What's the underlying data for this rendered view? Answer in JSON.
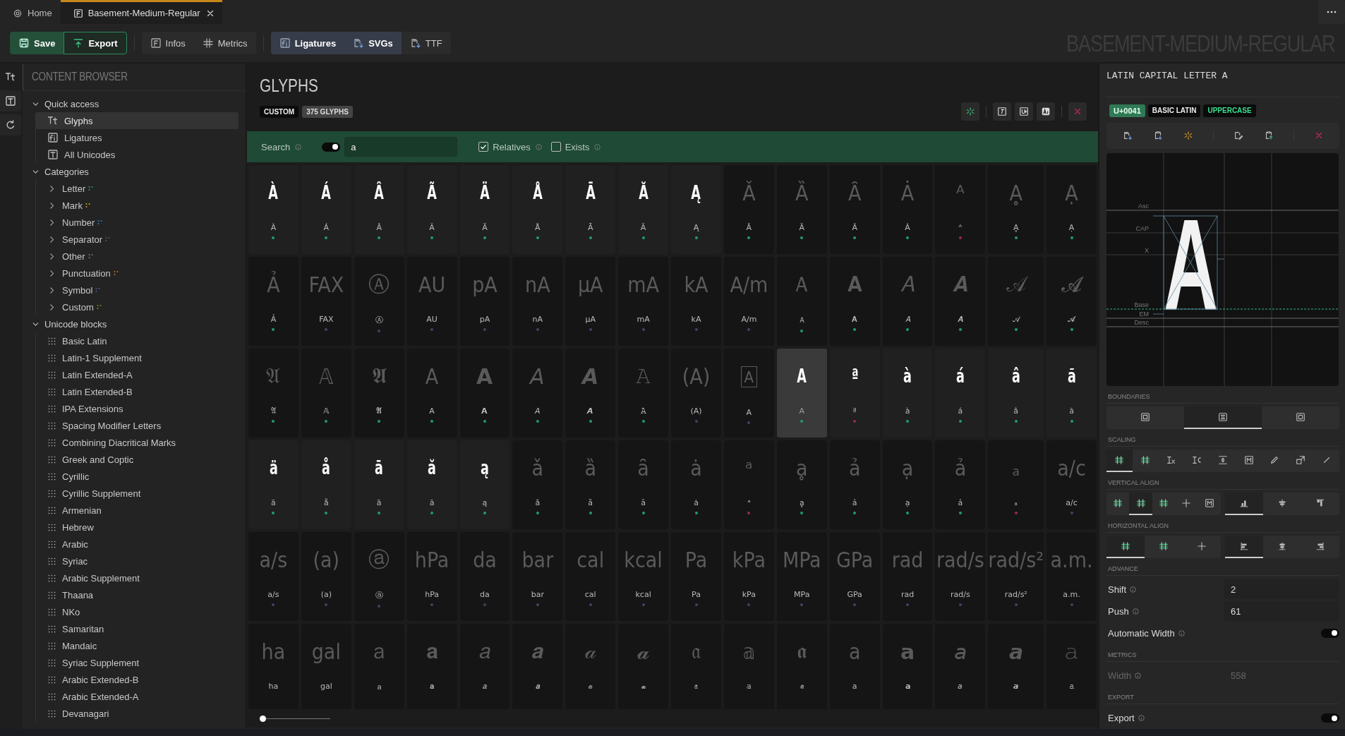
{
  "tabs": [
    {
      "label": "Home",
      "selected": false
    },
    {
      "label": "Basement-Medium-Regular",
      "selected": true
    }
  ],
  "toolbar": {
    "groups": [
      {
        "buttons": [
          {
            "label": "Save",
            "kind": "primary"
          },
          {
            "label": "Export",
            "kind": "outline"
          }
        ]
      },
      {
        "buttons": [
          {
            "label": "Infos",
            "kind": "plain"
          },
          {
            "label": "Metrics",
            "kind": "plain"
          }
        ]
      },
      {
        "buttons": [
          {
            "label": "Ligatures",
            "kind": "active"
          },
          {
            "label": "SVGs",
            "kind": "active"
          },
          {
            "label": "TTF",
            "kind": "plain"
          }
        ]
      }
    ],
    "font_title": "BASEMENT-MEDIUM-REGULAR"
  },
  "sidebar": {
    "title": "CONTENT BROWSER",
    "sections": [
      {
        "label": "Quick access",
        "kind": "quick",
        "expanded": true,
        "items": [
          {
            "label": "Glyphs",
            "selected": true
          },
          {
            "label": "Ligatures",
            "selected": false
          },
          {
            "label": "All Unicodes",
            "selected": false
          }
        ]
      },
      {
        "label": "Categories",
        "kind": "categories",
        "expanded": true,
        "items": [
          {
            "label": "Letter",
            "selected": false,
            "expanded": false,
            "color": "#2e9e6a"
          },
          {
            "label": "Mark",
            "selected": false,
            "expanded": false,
            "color": "#c9a51e"
          },
          {
            "label": "Number",
            "selected": false,
            "expanded": false,
            "color": "#2f7fc0"
          },
          {
            "label": "Separator",
            "selected": false,
            "expanded": false,
            "color": "#5a5a5a"
          },
          {
            "label": "Other",
            "selected": false,
            "expanded": false,
            "color": "#7a7a7a"
          },
          {
            "label": "Punctuation",
            "selected": false,
            "expanded": false,
            "color": "#b07a20"
          },
          {
            "label": "Symbol",
            "selected": false,
            "expanded": false,
            "color": "#4a5a80"
          },
          {
            "label": "Custom",
            "selected": false,
            "expanded": false,
            "color": "#6a9a20"
          }
        ]
      },
      {
        "label": "Unicode blocks",
        "kind": "blocks",
        "expanded": true,
        "items": [
          {
            "label": "Basic Latin",
            "selected": false
          },
          {
            "label": "Latin-1 Supplement",
            "selected": false
          },
          {
            "label": "Latin Extended-A",
            "selected": false
          },
          {
            "label": "Latin Extended-B",
            "selected": false
          },
          {
            "label": "IPA Extensions",
            "selected": false
          },
          {
            "label": "Spacing Modifier Letters",
            "selected": false
          },
          {
            "label": "Combining Diacritical Marks",
            "selected": false
          },
          {
            "label": "Greek and Coptic",
            "selected": false
          },
          {
            "label": "Cyrillic",
            "selected": false
          },
          {
            "label": "Cyrillic Supplement",
            "selected": false
          },
          {
            "label": "Armenian",
            "selected": false
          },
          {
            "label": "Hebrew",
            "selected": false
          },
          {
            "label": "Arabic",
            "selected": false
          },
          {
            "label": "Syriac",
            "selected": false
          },
          {
            "label": "Arabic Supplement",
            "selected": false
          },
          {
            "label": "Thaana",
            "selected": false
          },
          {
            "label": "NKo",
            "selected": false
          },
          {
            "label": "Samaritan",
            "selected": false
          },
          {
            "label": "Mandaic",
            "selected": false
          },
          {
            "label": "Syriac Supplement",
            "selected": false
          },
          {
            "label": "Arabic Extended-B",
            "selected": false
          },
          {
            "label": "Arabic Extended-A",
            "selected": false
          },
          {
            "label": "Devanagari",
            "selected": false
          }
        ]
      }
    ]
  },
  "glyphs_panel": {
    "title": "GLYPHS",
    "badges": [
      {
        "label": "CUSTOM",
        "kind": "dark"
      },
      {
        "label": "375 GLYPHS",
        "kind": "grey"
      }
    ],
    "search": {
      "label": "Search",
      "on": true,
      "value": "a"
    },
    "filters": [
      {
        "label": "Relatives",
        "checked": true
      },
      {
        "label": "Exists",
        "checked": false
      }
    ],
    "glyphs": [
      {
        "glyph": "À",
        "label": "À",
        "color": "#1f9d6b",
        "kind": "project",
        "selected": false
      },
      {
        "glyph": "Á",
        "label": "Á",
        "color": "#1f9d6b",
        "kind": "project",
        "selected": false
      },
      {
        "glyph": "Â",
        "label": "Â",
        "color": "#1f9d6b",
        "kind": "project",
        "selected": false
      },
      {
        "glyph": "Ã",
        "label": "Ã",
        "color": "#1f9d6b",
        "kind": "project",
        "selected": false
      },
      {
        "glyph": "Ä",
        "label": "Ä",
        "color": "#1f9d6b",
        "kind": "project",
        "selected": false
      },
      {
        "glyph": "Å",
        "label": "Å",
        "color": "#1f9d6b",
        "kind": "project",
        "selected": false
      },
      {
        "glyph": "Ā",
        "label": "Ā",
        "color": "#1f9d6b",
        "kind": "project",
        "selected": false
      },
      {
        "glyph": "Ă",
        "label": "Ă",
        "color": "#1f9d6b",
        "kind": "project",
        "selected": false
      },
      {
        "glyph": "Ą",
        "label": "Ą",
        "color": "#1f9d6b",
        "kind": "project",
        "selected": false
      },
      {
        "glyph": "Ǎ",
        "label": "Ǎ",
        "color": "#1f9d6b",
        "kind": "system",
        "selected": false
      },
      {
        "glyph": "Ȁ",
        "label": "Ȁ",
        "color": "#1f9d6b",
        "kind": "system",
        "selected": false
      },
      {
        "glyph": "Ȃ",
        "label": "Ȃ",
        "color": "#1f9d6b",
        "kind": "system",
        "selected": false
      },
      {
        "glyph": "Ȧ",
        "label": "Ȧ",
        "color": "#1f9d6b",
        "kind": "system",
        "selected": false
      },
      {
        "glyph": "ᴬ",
        "label": "ᴬ",
        "color": "#a0245a",
        "kind": "system",
        "selected": false
      },
      {
        "glyph": "Ḁ",
        "label": "Ḁ",
        "color": "#1f9d6b",
        "kind": "system",
        "selected": false
      },
      {
        "glyph": "Ạ",
        "label": "Ạ",
        "color": "#1f9d6b",
        "kind": "system",
        "selected": false
      },
      {
        "glyph": "Ả",
        "label": "Ả",
        "color": "#1f9d6b",
        "kind": "system",
        "selected": false
      },
      {
        "glyph": "FAX",
        "label": "FAX",
        "color": "#3b4660",
        "kind": "system",
        "selected": false
      },
      {
        "glyph": "Ⓐ",
        "label": "Ⓐ",
        "color": "#3b4660",
        "kind": "system",
        "selected": false
      },
      {
        "glyph": "AU",
        "label": "AU",
        "color": "#3b4660",
        "kind": "system",
        "selected": false
      },
      {
        "glyph": "pA",
        "label": "pA",
        "color": "#3b4660",
        "kind": "system",
        "selected": false
      },
      {
        "glyph": "nA",
        "label": "nA",
        "color": "#3b4660",
        "kind": "system",
        "selected": false
      },
      {
        "glyph": "μA",
        "label": "μA",
        "color": "#3b4660",
        "kind": "system",
        "selected": false
      },
      {
        "glyph": "mA",
        "label": "mA",
        "color": "#3b4660",
        "kind": "system",
        "selected": false
      },
      {
        "glyph": "kA",
        "label": "kA",
        "color": "#3b4660",
        "kind": "system",
        "selected": false
      },
      {
        "glyph": "A/m",
        "label": "A/m",
        "color": "#3b4660",
        "kind": "system",
        "selected": false
      },
      {
        "glyph": "Ａ",
        "label": "Ａ",
        "color": "#1f9d6b",
        "kind": "system",
        "selected": false
      },
      {
        "glyph": "𝐀",
        "label": "𝐀",
        "color": "#1f9d6b",
        "kind": "system",
        "selected": false
      },
      {
        "glyph": "𝐴",
        "label": "𝐴",
        "color": "#1f9d6b",
        "kind": "system",
        "selected": false
      },
      {
        "glyph": "𝑨",
        "label": "𝑨",
        "color": "#1f9d6b",
        "kind": "system",
        "selected": false
      },
      {
        "glyph": "𝒜",
        "label": "𝒜",
        "color": "#1f9d6b",
        "kind": "system",
        "selected": false
      },
      {
        "glyph": "𝓐",
        "label": "𝓐",
        "color": "#1f9d6b",
        "kind": "system",
        "selected": false
      },
      {
        "glyph": "𝔄",
        "label": "𝔄",
        "color": "#1f9d6b",
        "kind": "system",
        "selected": false
      },
      {
        "glyph": "𝔸",
        "label": "𝔸",
        "color": "#1f9d6b",
        "kind": "system",
        "selected": false
      },
      {
        "glyph": "𝕬",
        "label": "𝕬",
        "color": "#1f9d6b",
        "kind": "system",
        "selected": false
      },
      {
        "glyph": "𝖠",
        "label": "𝖠",
        "color": "#1f9d6b",
        "kind": "system",
        "selected": false
      },
      {
        "glyph": "𝗔",
        "label": "𝗔",
        "color": "#1f9d6b",
        "kind": "system",
        "selected": false
      },
      {
        "glyph": "𝘈",
        "label": "𝘈",
        "color": "#1f9d6b",
        "kind": "system",
        "selected": false
      },
      {
        "glyph": "𝘼",
        "label": "𝘼",
        "color": "#1f9d6b",
        "kind": "system",
        "selected": false
      },
      {
        "glyph": "𝙰",
        "label": "𝙰",
        "color": "#1f9d6b",
        "kind": "system",
        "selected": false
      },
      {
        "glyph": "(A)",
        "label": "(A)",
        "color": "#3b4660",
        "kind": "system",
        "selected": false
      },
      {
        "glyph": "A",
        "label": "A",
        "color": "#3b4660",
        "kind": "boxed",
        "selected": false
      },
      {
        "glyph": "A",
        "label": "A",
        "color": "#1f9d6b",
        "kind": "project",
        "selected": true
      },
      {
        "glyph": "ª",
        "label": "ª",
        "color": "#a0245a",
        "kind": "project",
        "selected": false
      },
      {
        "glyph": "à",
        "label": "à",
        "color": "#1f9d6b",
        "kind": "project",
        "selected": false
      },
      {
        "glyph": "á",
        "label": "á",
        "color": "#1f9d6b",
        "kind": "project",
        "selected": false
      },
      {
        "glyph": "â",
        "label": "â",
        "color": "#1f9d6b",
        "kind": "project",
        "selected": false
      },
      {
        "glyph": "ã",
        "label": "ã",
        "color": "#1f9d6b",
        "kind": "project",
        "selected": false
      },
      {
        "glyph": "ä",
        "label": "ä",
        "color": "#1f9d6b",
        "kind": "project",
        "selected": false
      },
      {
        "glyph": "å",
        "label": "å",
        "color": "#1f9d6b",
        "kind": "project",
        "selected": false
      },
      {
        "glyph": "ā",
        "label": "ā",
        "color": "#1f9d6b",
        "kind": "project",
        "selected": false
      },
      {
        "glyph": "ă",
        "label": "ă",
        "color": "#1f9d6b",
        "kind": "project",
        "selected": false
      },
      {
        "glyph": "ą",
        "label": "ą",
        "color": "#1f9d6b",
        "kind": "project",
        "selected": false
      },
      {
        "glyph": "ǎ",
        "label": "ǎ",
        "color": "#1f9d6b",
        "kind": "system",
        "selected": false
      },
      {
        "glyph": "ȁ",
        "label": "ȁ",
        "color": "#1f9d6b",
        "kind": "system",
        "selected": false
      },
      {
        "glyph": "ȃ",
        "label": "ȃ",
        "color": "#1f9d6b",
        "kind": "system",
        "selected": false
      },
      {
        "glyph": "ȧ",
        "label": "ȧ",
        "color": "#1f9d6b",
        "kind": "system",
        "selected": false
      },
      {
        "glyph": "ᵃ",
        "label": "ᵃ",
        "color": "#a0245a",
        "kind": "system",
        "selected": false
      },
      {
        "glyph": "ḁ",
        "label": "ḁ",
        "color": "#1f9d6b",
        "kind": "system",
        "selected": false
      },
      {
        "glyph": "ả",
        "label": "ả",
        "color": "#1f9d6b",
        "kind": "system",
        "selected": false
      },
      {
        "glyph": "ạ",
        "label": "ạ",
        "color": "#1f9d6b",
        "kind": "system",
        "selected": false
      },
      {
        "glyph": "ả",
        "label": "ả",
        "color": "#1f9d6b",
        "kind": "system",
        "selected": false
      },
      {
        "glyph": "ₐ",
        "label": "ₐ",
        "color": "#a0245a",
        "kind": "system",
        "selected": false
      },
      {
        "glyph": "a/c",
        "label": "a/c",
        "color": "#3b4660",
        "kind": "system",
        "selected": false
      },
      {
        "glyph": "a/s",
        "label": "a/s",
        "color": "#3b4660",
        "kind": "system",
        "selected": false
      },
      {
        "glyph": "(a)",
        "label": "(a)",
        "color": "#3b4660",
        "kind": "system",
        "selected": false
      },
      {
        "glyph": "ⓐ",
        "label": "ⓐ",
        "color": "#3b4660",
        "kind": "system",
        "selected": false
      },
      {
        "glyph": "hPa",
        "label": "hPa",
        "color": "#3b4660",
        "kind": "system",
        "selected": false
      },
      {
        "glyph": "da",
        "label": "da",
        "color": "#3b4660",
        "kind": "system",
        "selected": false
      },
      {
        "glyph": "bar",
        "label": "bar",
        "color": "#3b4660",
        "kind": "system",
        "selected": false
      },
      {
        "glyph": "cal",
        "label": "cal",
        "color": "#3b4660",
        "kind": "system",
        "selected": false
      },
      {
        "glyph": "kcal",
        "label": "kcal",
        "color": "#3b4660",
        "kind": "system",
        "selected": false
      },
      {
        "glyph": "Pa",
        "label": "Pa",
        "color": "#3b4660",
        "kind": "system",
        "selected": false
      },
      {
        "glyph": "kPa",
        "label": "kPa",
        "color": "#3b4660",
        "kind": "system",
        "selected": false
      },
      {
        "glyph": "MPa",
        "label": "MPa",
        "color": "#3b4660",
        "kind": "system",
        "selected": false
      },
      {
        "glyph": "GPa",
        "label": "GPa",
        "color": "#3b4660",
        "kind": "system",
        "selected": false
      },
      {
        "glyph": "rad",
        "label": "rad",
        "color": "#3b4660",
        "kind": "system",
        "selected": false
      },
      {
        "glyph": "rad/s",
        "label": "rad/s",
        "color": "#3b4660",
        "kind": "system",
        "selected": false
      },
      {
        "glyph": "rad/s²",
        "label": "rad/s²",
        "color": "#3b4660",
        "kind": "system",
        "selected": false
      },
      {
        "glyph": "a.m.",
        "label": "a.m.",
        "color": "#3b4660",
        "kind": "system",
        "selected": false
      },
      {
        "glyph": "ha",
        "label": "ha",
        "kind": "system",
        "selected": false
      },
      {
        "glyph": "gal",
        "label": "gal",
        "kind": "system",
        "selected": false
      },
      {
        "glyph": "ａ",
        "label": "ａ",
        "kind": "system",
        "selected": false
      },
      {
        "glyph": "𝐚",
        "label": "𝐚",
        "kind": "system",
        "selected": false
      },
      {
        "glyph": "𝑎",
        "label": "𝑎",
        "kind": "system",
        "selected": false
      },
      {
        "glyph": "𝒂",
        "label": "𝒂",
        "kind": "system",
        "selected": false
      },
      {
        "glyph": "𝒶",
        "label": "𝒶",
        "kind": "system",
        "selected": false
      },
      {
        "glyph": "𝓪",
        "label": "𝓪",
        "kind": "system",
        "selected": false
      },
      {
        "glyph": "𝔞",
        "label": "𝔞",
        "kind": "system",
        "selected": false
      },
      {
        "glyph": "𝕒",
        "label": "𝕒",
        "kind": "system",
        "selected": false
      },
      {
        "glyph": "𝖆",
        "label": "𝖆",
        "kind": "system",
        "selected": false
      },
      {
        "glyph": "𝖺",
        "label": "𝖺",
        "kind": "system",
        "selected": false
      },
      {
        "glyph": "𝗮",
        "label": "𝗮",
        "kind": "system",
        "selected": false
      },
      {
        "glyph": "𝘢",
        "label": "𝘢",
        "kind": "system",
        "selected": false
      },
      {
        "glyph": "𝙖",
        "label": "𝙖",
        "kind": "system",
        "selected": false
      },
      {
        "glyph": "𝚊",
        "label": "𝚊",
        "kind": "system",
        "selected": false
      }
    ],
    "zoom": {
      "level": 0
    }
  },
  "inspector": {
    "title": "LATIN CAPITAL LETTER A",
    "badges": [
      {
        "label": "U+0041",
        "kind": "code"
      },
      {
        "label": "BASIC LATIN",
        "kind": "dark"
      },
      {
        "label": "UPPERCASE",
        "kind": "accent"
      }
    ],
    "preview": {
      "glyph": "A",
      "guides": [
        "Asc",
        "CAP",
        "X",
        "Base",
        "EM",
        "Desc"
      ]
    },
    "boundaries": {
      "title": "BOUNDARIES",
      "groups": [
        {
          "options": [
            {
              "selected": false
            },
            {
              "selected": true
            },
            {
              "selected": false
            }
          ]
        }
      ]
    },
    "scaling": {
      "title": "SCALING",
      "groups": [
        {
          "options": [
            {
              "selected": true
            },
            {
              "selected": false
            },
            {
              "selected": false
            },
            {
              "selected": false
            },
            {
              "selected": false
            },
            {
              "selected": false
            },
            {
              "selected": false
            },
            {
              "selected": false
            },
            {
              "selected": false
            }
          ]
        }
      ]
    },
    "vertical_align": {
      "title": "VERTICAL ALIGN",
      "groups": [
        {
          "options": [
            {
              "selected": false
            },
            {
              "selected": true
            },
            {
              "selected": false
            },
            {
              "selected": false
            },
            {
              "selected": false
            }
          ]
        },
        {
          "options": [
            {
              "selected": true
            },
            {
              "selected": false
            },
            {
              "selected": false
            }
          ]
        }
      ]
    },
    "horizontal_align": {
      "title": "HORIZONTAL ALIGN",
      "groups": [
        {
          "options": [
            {
              "selected": true
            },
            {
              "selected": false
            },
            {
              "selected": false
            }
          ]
        },
        {
          "options": [
            {
              "selected": true
            },
            {
              "selected": false
            },
            {
              "selected": false
            }
          ]
        }
      ]
    },
    "advance": {
      "title": "ADVANCE",
      "fields": [
        {
          "label": "Shift",
          "value": "2",
          "disabled": false
        },
        {
          "label": "Push",
          "value": "61",
          "disabled": false
        }
      ],
      "toggle": {
        "label": "Automatic Width",
        "on": true
      }
    },
    "metrics": {
      "title": "METRICS",
      "fields": [
        {
          "label": "Width",
          "value": "558",
          "disabled": true
        }
      ]
    },
    "export": {
      "title": "EXPORT",
      "toggle": {
        "label": "Export",
        "on": true
      }
    }
  }
}
